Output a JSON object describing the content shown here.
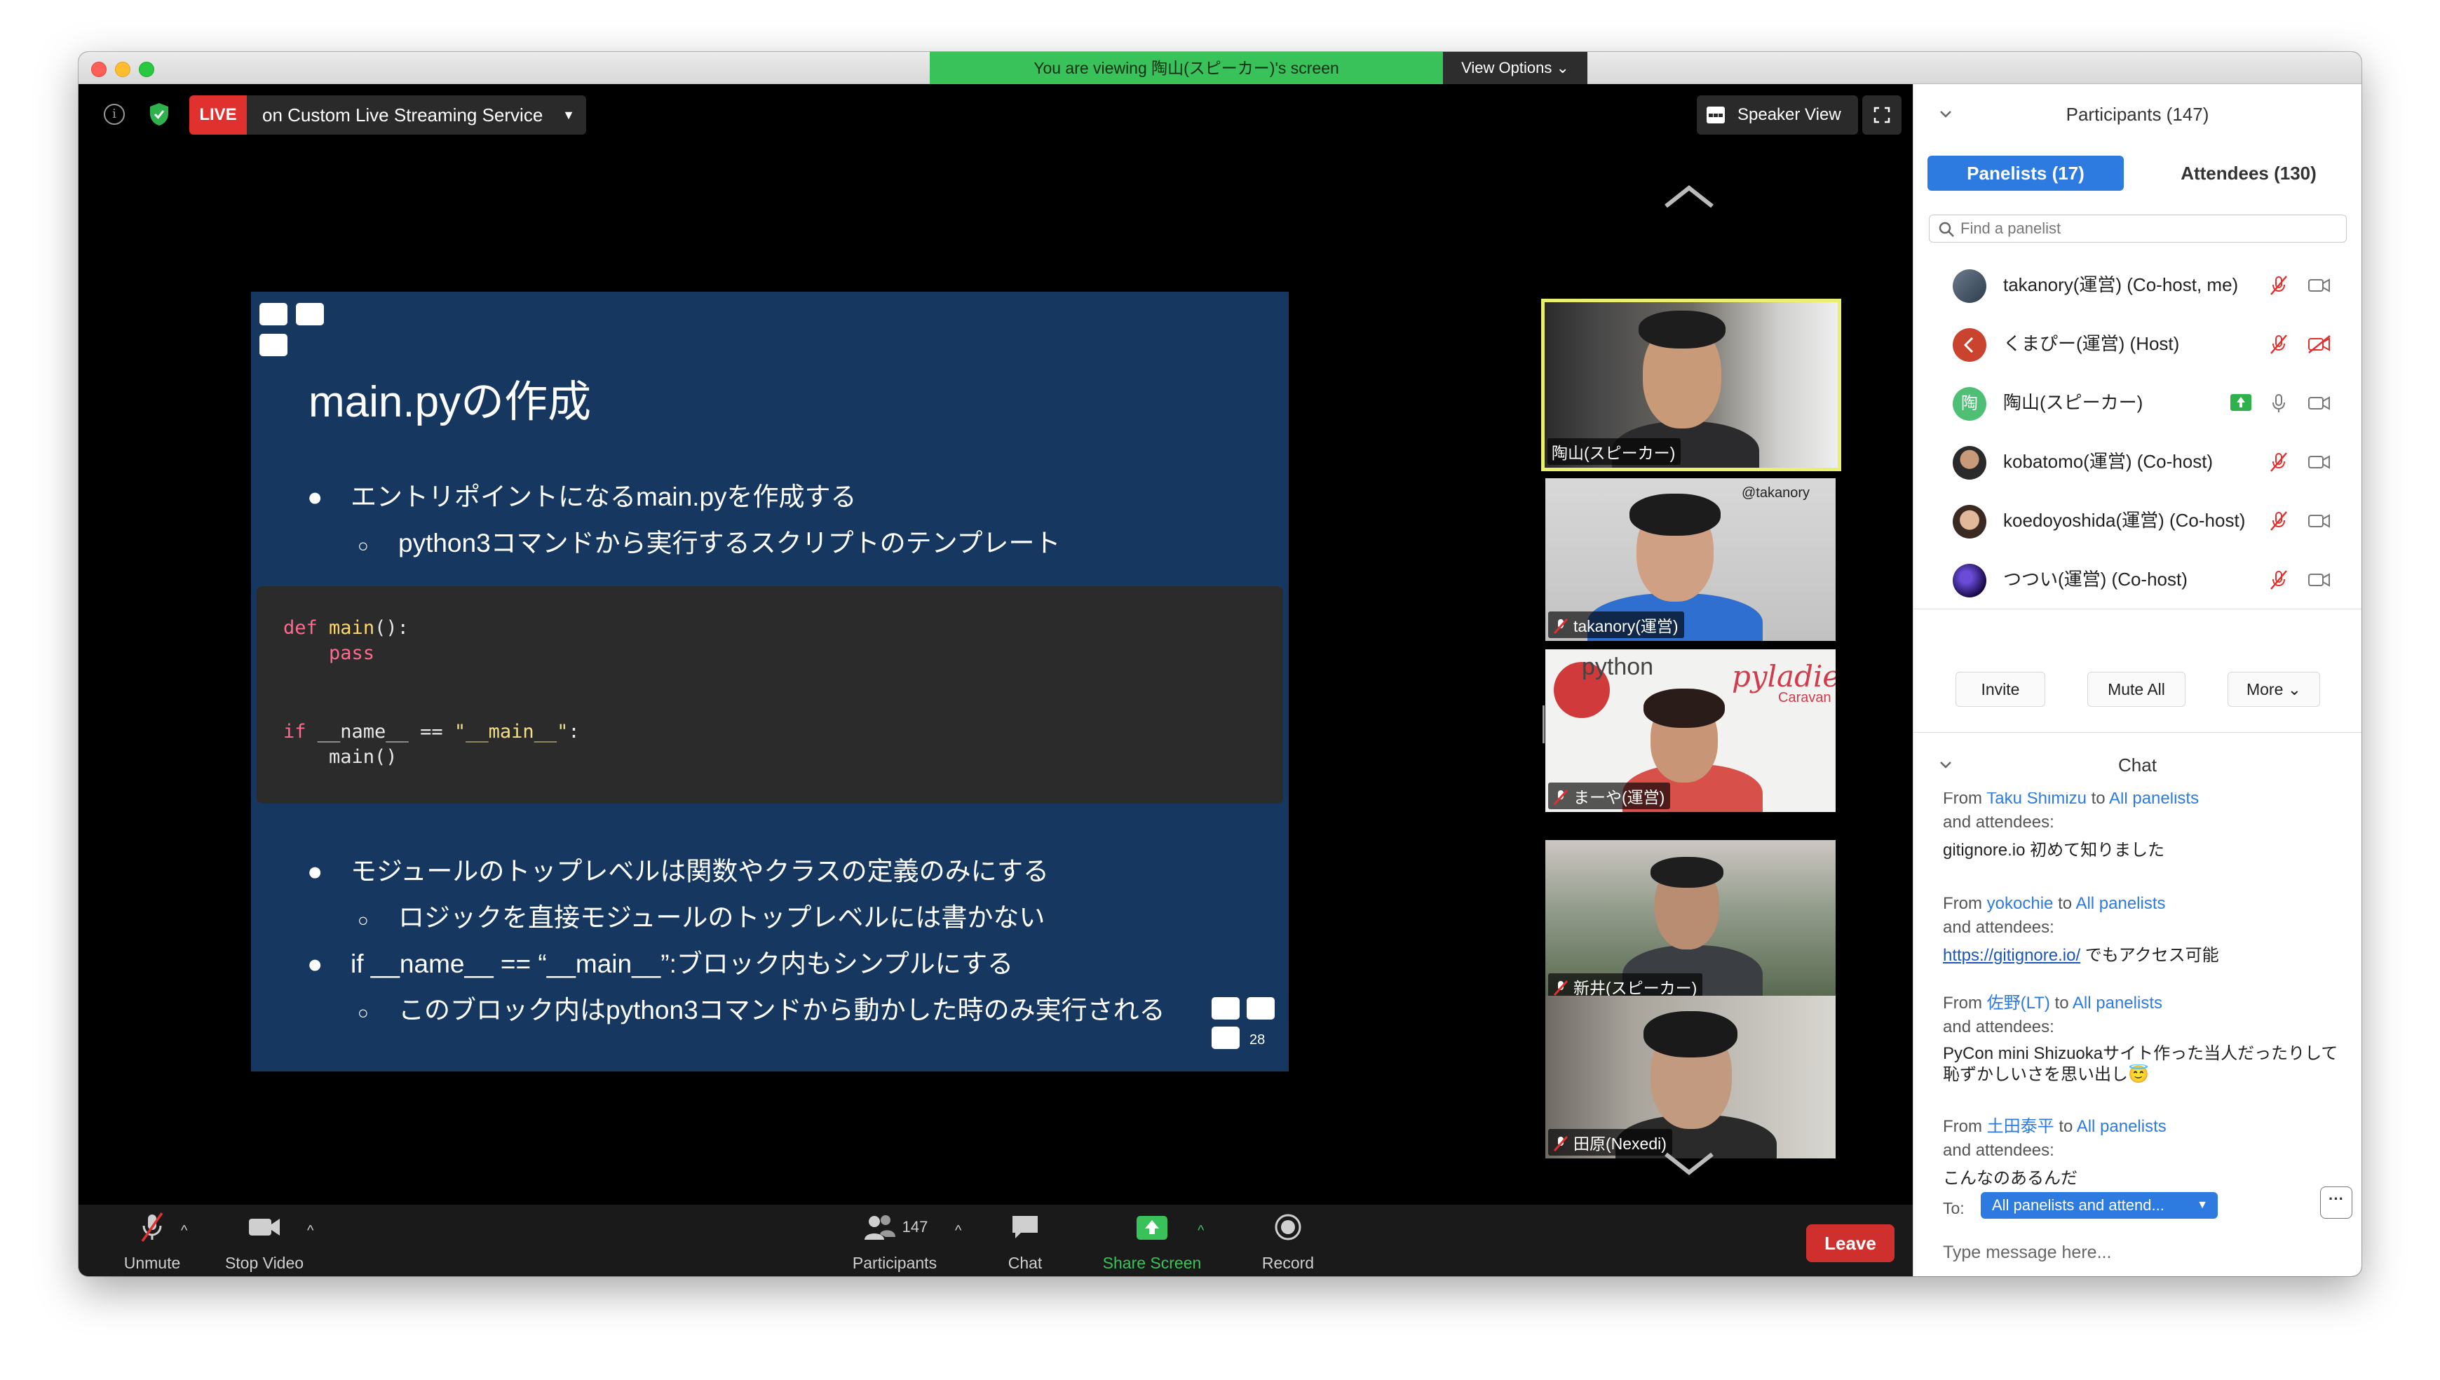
{
  "window": {
    "viewing_banner": "You are viewing 陶山(スピーカー)'s screen",
    "view_options": "View Options"
  },
  "stage": {
    "live_badge": "LIVE",
    "live_service": "on Custom Live Streaming Service",
    "speaker_view": "Speaker View"
  },
  "slide": {
    "title": "main.pyの作成",
    "bullets": [
      "エントリポイントになるmain.pyを作成する",
      "python3コマンドから実行するスクリプトのテンプレート",
      "モジュールのトップレベルは関数やクラスの定義のみにする",
      "ロジックを直接モジュールのトップレベルには書かない",
      "if __name__ == “__main__”:ブロック内もシンプルにする",
      "このブロック内はpython3コマンドから動かした時のみ実行される"
    ],
    "bullet_glyph": "●",
    "sub_glyph": "○",
    "code": {
      "def_kw": "def",
      "main_fn": "main",
      "def_rest": "():",
      "pass_kw": "pass",
      "if_kw": "if",
      "if_mid": " __name__ == ",
      "if_str": "\"__main__\"",
      "if_end": ":",
      "call": "main()"
    },
    "page_number": "28"
  },
  "video_tiles": [
    {
      "name": "陶山(スピーカー)"
    },
    {
      "name": "takanory(運営)"
    },
    {
      "name": "まーや(運営)"
    },
    {
      "name": "新井(スピーカー)"
    },
    {
      "name": "田原(Nexedi)"
    }
  ],
  "tile_bg_text": {
    "tile2_sign": "@takanory",
    "tile3_python": "python",
    "tile3_pyladies": "pyladies",
    "tile3_caravan": "Caravan"
  },
  "toolbar": {
    "unmute": "Unmute",
    "stop_video": "Stop Video",
    "participants": "Participants",
    "participants_count": "147",
    "chat": "Chat",
    "share_screen": "Share Screen",
    "record": "Record",
    "leave": "Leave",
    "caret": "^"
  },
  "participants_panel": {
    "title": "Participants (147)",
    "tab_panelists": "Panelists (17)",
    "tab_attendees": "Attendees (130)",
    "search_placeholder": "Find a panelist",
    "panelists": [
      {
        "name": "takanory(運営) (Co-host, me)"
      },
      {
        "name": "くまぴー(運営) (Host)"
      },
      {
        "name": "陶山(スピーカー)",
        "avatar_letter": "陶"
      },
      {
        "name": "kobatomo(運営) (Co-host)"
      },
      {
        "name": "koedoyoshida(運営) (Co-host)"
      },
      {
        "name": "つつい(運営) (Co-host)"
      }
    ],
    "invite": "Invite",
    "mute_all": "Mute All",
    "more": "More"
  },
  "chat": {
    "title": "Chat",
    "messages": [
      {
        "from": "From ",
        "sender": "Taku Shimizu",
        "to": " to ",
        "recipients": "All panelists",
        "tail": "and attendees:",
        "text": "gitignore.io 初めて知りました"
      },
      {
        "from": "From ",
        "sender": "yokochie",
        "to": " to ",
        "recipients": "All panelists",
        "tail": "and attendees:",
        "link": "https://gitignore.io/",
        "text": " でもアクセス可能"
      },
      {
        "from": "From ",
        "sender": "佐野(LT)",
        "to": " to ",
        "recipients": "All panelists",
        "tail": "and attendees:",
        "text": "PyCon mini Shizuokaサイト作った当人だったりして恥ずかしいさを思い出し😇"
      },
      {
        "from": "From ",
        "sender": "土田泰平",
        "to": " to ",
        "recipients": "All panelists",
        "tail": "and attendees:",
        "text": "こんなのあるんだ"
      }
    ],
    "to_label": "To:",
    "to_value": "All panelists and attend...",
    "dots": "···",
    "input_placeholder": "Type message here..."
  },
  "colors": {
    "accent": "#2d7ae0",
    "live_red": "#e0312f",
    "leave_red": "#d0302d",
    "share_green": "#3ac25a",
    "slide_bg": "#163760",
    "active_speaker_border": "#e9f06b",
    "mute_red": "#e0312f"
  }
}
